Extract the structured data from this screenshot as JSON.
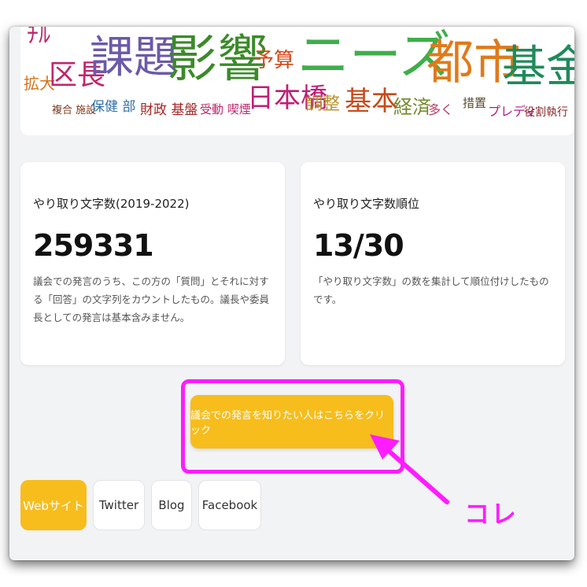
{
  "wordcloud": {
    "words": [
      {
        "text": "ﾁﾙ",
        "color": "#c0266c"
      },
      {
        "text": "拡大",
        "color": "#d4731a"
      },
      {
        "text": "区長",
        "color": "#c0266c"
      },
      {
        "text": "複合 施設",
        "color": "#7c3a1c"
      },
      {
        "text": "課題",
        "color": "#6a5aa8"
      },
      {
        "text": "保健 部",
        "color": "#2f6fa8"
      },
      {
        "text": "財政 基盤",
        "color": "#a52424"
      },
      {
        "text": "影響",
        "color": "#3b8a2a"
      },
      {
        "text": "受動 喫煙",
        "color": "#c0266c"
      },
      {
        "text": "予算",
        "color": "#d44a1a"
      },
      {
        "text": "日本橋",
        "color": "#c01e78"
      },
      {
        "text": "ニーズ",
        "color": "#3fae4a"
      },
      {
        "text": "調整",
        "color": "#b8932a"
      },
      {
        "text": "基本",
        "color": "#c84a1a"
      },
      {
        "text": "経済",
        "color": "#6f8a2a"
      },
      {
        "text": "都市",
        "color": "#e07a1a"
      },
      {
        "text": "多く",
        "color": "#c03a6a"
      },
      {
        "text": "措置",
        "color": "#5a4a2a"
      },
      {
        "text": "プレディ",
        "color": "#b0208a"
      },
      {
        "text": "基金",
        "color": "#1f8a5a"
      },
      {
        "text": "役割執行",
        "color": "#8a2a2a"
      }
    ]
  },
  "cards": [
    {
      "title": "やり取り文字数(2019-2022)",
      "value": "259331",
      "description": "議会での発言のうち、この方の「質問」とそれに対する「回答」の文字列をカウントしたもの。議長や委員長としての発言は基本含みません。"
    },
    {
      "title": "やり取り文字数順位",
      "value": "13/30",
      "description": "「やり取り文字数」の数を集計して順位付けしたものです。"
    }
  ],
  "cta": {
    "label": "議会での発言を知りたい人はこちらをクリック"
  },
  "tabs": [
    {
      "label": "Webサイト",
      "active": true
    },
    {
      "label": "Twitter",
      "active": false
    },
    {
      "label": "Blog",
      "active": false
    },
    {
      "label": "Facebook",
      "active": false
    }
  ],
  "annotation": {
    "text": "コレ",
    "color": "#ff1cff"
  },
  "colors": {
    "accent": "#f7bd1d",
    "highlight": "#ff1cff",
    "background": "#f2f3f5"
  }
}
